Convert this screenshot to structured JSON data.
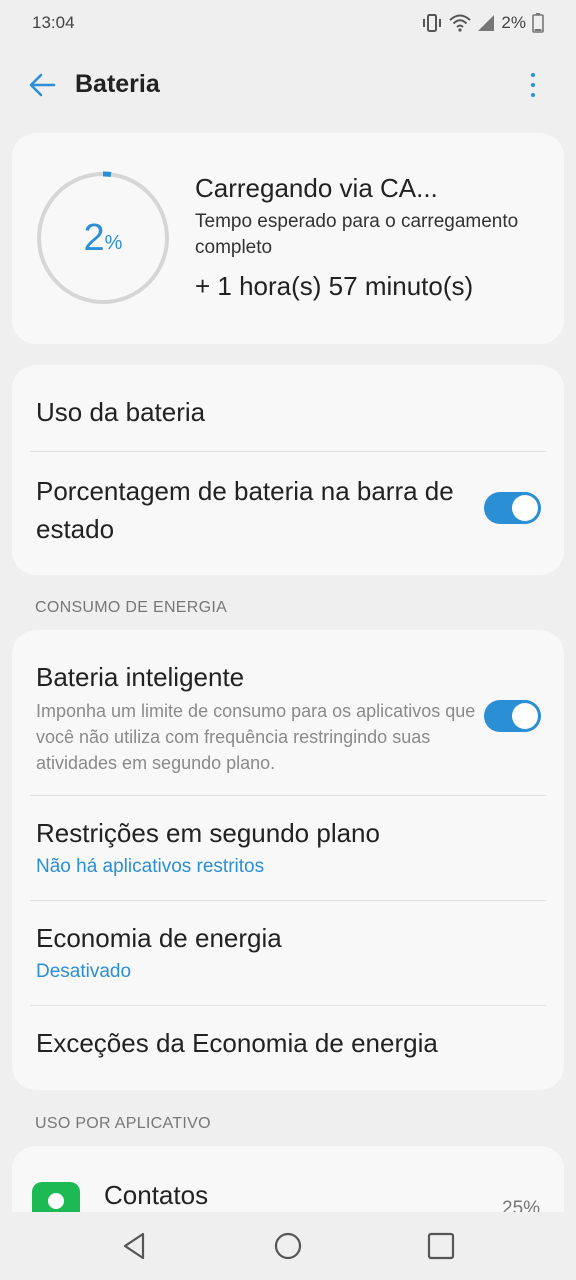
{
  "status": {
    "time": "13:04",
    "battery": "2%"
  },
  "header": {
    "title": "Bateria"
  },
  "charge": {
    "percent_value": "2",
    "percent_unit": "%",
    "percent_fraction": 0.02,
    "title": "Carregando via CA...",
    "subtitle": "Tempo esperado para o carregamento completo",
    "time_left": "+ 1 hora(s) 57 minuto(s)"
  },
  "settings1": {
    "battery_usage": "Uso da bateria",
    "percentage_status": "Porcentagem de bateria na barra de estado",
    "percentage_status_on": true
  },
  "section_energy": {
    "label": "CONSUMO DE ENERGIA"
  },
  "energy": {
    "smart_battery": "Bateria inteligente",
    "smart_battery_desc": "Imponha um limite de consumo para os aplicativos que você não utiliza com frequência restringindo suas atividades em segundo plano.",
    "smart_battery_on": true,
    "background_restrictions": "Restrições em segundo plano",
    "background_restrictions_sub": "Não há aplicativos restritos",
    "power_saving": "Economia de energia",
    "power_saving_sub": "Desativado",
    "power_saving_exceptions": "Exceções da Economia de energia"
  },
  "section_apps": {
    "label": "USO POR APLICATIVO"
  },
  "apps": [
    {
      "name": "Contatos",
      "usage": "25%"
    }
  ],
  "colors": {
    "accent": "#2b8fd6",
    "contacts_icon": "#1db954"
  }
}
